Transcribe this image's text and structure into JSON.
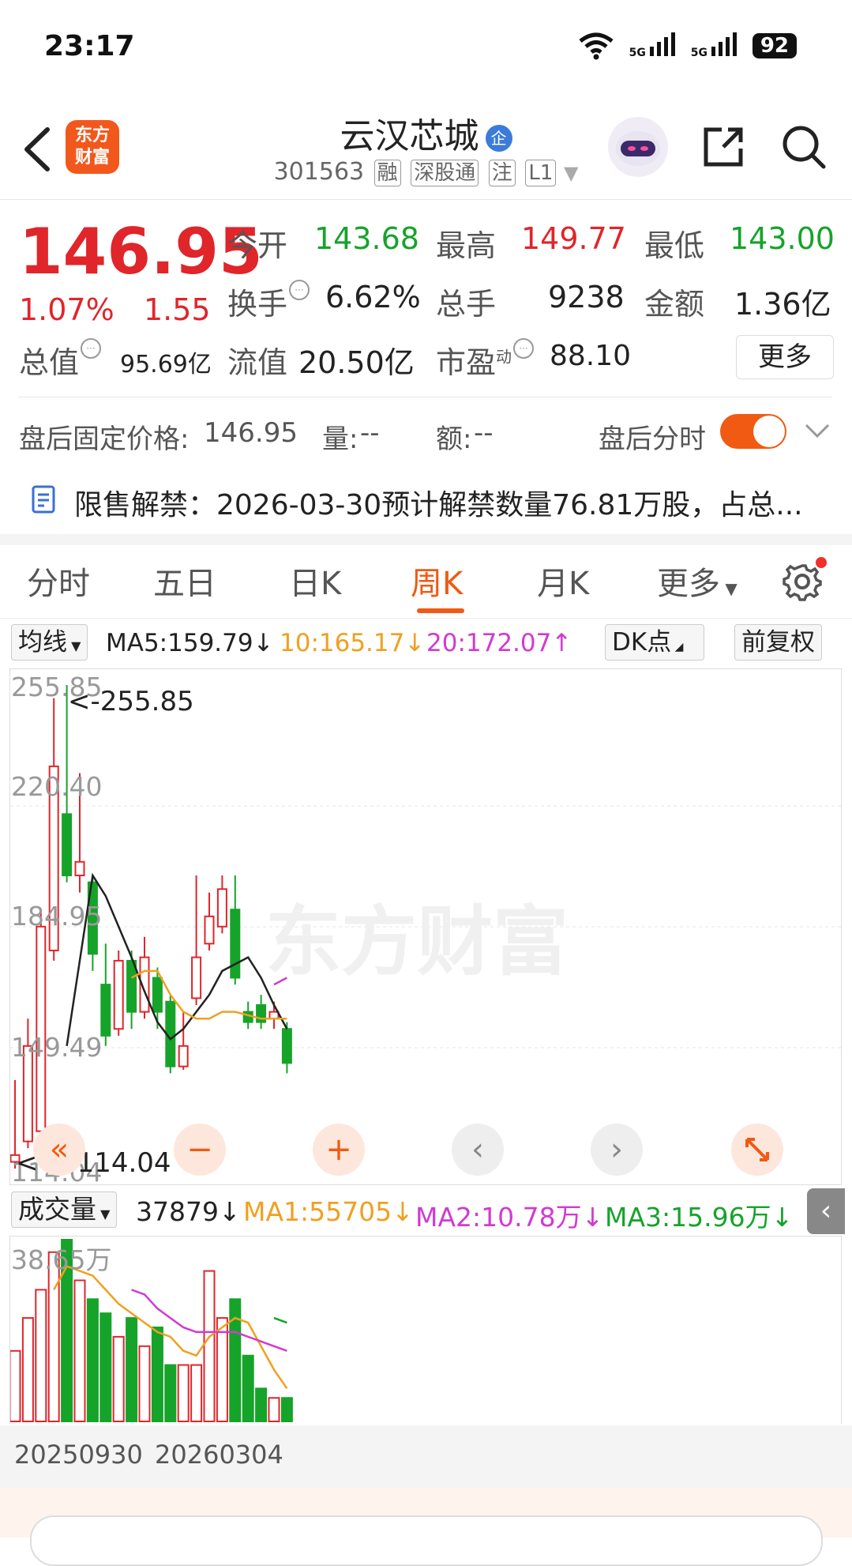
{
  "status": {
    "time": "23:17",
    "network1": "5G",
    "network2": "5G",
    "battery": "92"
  },
  "header": {
    "logo_text_1": "东方",
    "logo_text_2": "财富",
    "title": "云汉芯城",
    "title_badge": "企",
    "code": "301563",
    "tags": [
      "融",
      "深股通",
      "注",
      "L1"
    ]
  },
  "quote": {
    "price": "146.95",
    "change_pct": "1.07%",
    "change": "1.55",
    "open_label": "今开",
    "open": "143.68",
    "high_label": "最高",
    "high": "149.77",
    "low_label": "最低",
    "low": "143.00",
    "turnover_label": "换手",
    "turnover": "6.62%",
    "volume_label": "总手",
    "volume": "9238",
    "amount_label": "金额",
    "amount": "1.36亿",
    "total_cap_label": "总值",
    "total_cap": "95.69亿",
    "float_cap_label": "流值",
    "float_cap": "20.50亿",
    "pe_label": "市盈",
    "pe_sup": "动",
    "pe": "88.10",
    "more_label": "更多"
  },
  "after_hours": {
    "price_label": "盘后固定价格:",
    "price": "146.95",
    "vol_label": "量:",
    "vol": "--",
    "amt_label": "额:",
    "amt": "--",
    "toggle_label": "盘后分时"
  },
  "notice": {
    "text": "限售解禁：2026-03-30预计解禁数量76.81万股，占总..."
  },
  "tabs": [
    "分时",
    "五日",
    "日K",
    "周K",
    "月K",
    "更多"
  ],
  "active_tab": "周K",
  "ma_bar": {
    "selector": "均线",
    "ma5": "MA5:159.79↓",
    "ma10": "10:165.17↓",
    "ma20": "20:172.07↑",
    "dk_label": "DK点",
    "adjust_label": "前复权"
  },
  "chart_labels": {
    "y1": "255.85",
    "y2": "220.40",
    "y3": "184.95",
    "y4": "149.49",
    "y5": "114.04",
    "max_marker": "<-255.85",
    "min_marker": "<----114.04",
    "watermark": "东方财富"
  },
  "vol_bar": {
    "selector": "成交量",
    "value": "37879↓",
    "ma1": "MA1:55705↓",
    "ma2": "MA2:10.78万↓",
    "ma3": "MA3:15.96万↓"
  },
  "vol_labels": {
    "max": "38.65万"
  },
  "dates": {
    "start": "20250930",
    "end": "20260304"
  },
  "colors": {
    "up": "#e0252b",
    "down": "#16a32a",
    "accent": "#f05a13",
    "ma5": "#222222",
    "ma10": "#f0a020",
    "ma20": "#d23ad2"
  },
  "chart_data": {
    "type": "candlestick",
    "ylim": [
      114.04,
      255.85
    ],
    "candles": [
      {
        "o": 116,
        "c": 118,
        "h": 140,
        "l": 114.04
      },
      {
        "o": 122,
        "c": 150,
        "h": 158,
        "l": 120
      },
      {
        "o": 125,
        "c": 185,
        "h": 190,
        "l": 124
      },
      {
        "o": 178,
        "c": 232,
        "h": 252,
        "l": 175
      },
      {
        "o": 218,
        "c": 200,
        "h": 255.85,
        "l": 198
      },
      {
        "o": 200,
        "c": 204,
        "h": 230,
        "l": 195
      },
      {
        "o": 198,
        "c": 177,
        "h": 200,
        "l": 172
      },
      {
        "o": 168,
        "c": 153,
        "h": 180,
        "l": 150
      },
      {
        "o": 155,
        "c": 175,
        "h": 178,
        "l": 153
      },
      {
        "o": 175,
        "c": 160,
        "h": 178,
        "l": 155
      },
      {
        "o": 160,
        "c": 176,
        "h": 182,
        "l": 158
      },
      {
        "o": 170,
        "c": 160,
        "h": 173,
        "l": 155
      },
      {
        "o": 163,
        "c": 144,
        "h": 165,
        "l": 142
      },
      {
        "o": 144,
        "c": 150,
        "h": 160,
        "l": 143
      },
      {
        "o": 164,
        "c": 176,
        "h": 200,
        "l": 162
      },
      {
        "o": 180,
        "c": 188,
        "h": 195,
        "l": 178
      },
      {
        "o": 185,
        "c": 196,
        "h": 200,
        "l": 183
      },
      {
        "o": 190,
        "c": 170,
        "h": 200,
        "l": 168
      },
      {
        "o": 160,
        "c": 157,
        "h": 163,
        "l": 155
      },
      {
        "o": 162,
        "c": 157,
        "h": 165,
        "l": 155
      },
      {
        "o": 158,
        "c": 160,
        "h": 163,
        "l": 155
      },
      {
        "o": 155,
        "c": 145,
        "h": 157,
        "l": 142
      }
    ],
    "ma5": [
      null,
      null,
      null,
      null,
      150,
      175,
      200,
      194,
      185,
      176,
      166,
      157,
      152,
      155,
      160,
      165,
      172,
      174,
      176,
      170,
      162,
      155
    ],
    "ma10": [
      null,
      null,
      null,
      null,
      null,
      null,
      null,
      null,
      null,
      170,
      172,
      172,
      165,
      160,
      158,
      158,
      160,
      160,
      159,
      158,
      158,
      158
    ],
    "ma20": [
      null,
      null,
      null,
      null,
      null,
      null,
      null,
      null,
      null,
      null,
      null,
      null,
      null,
      null,
      null,
      null,
      null,
      null,
      null,
      null,
      168,
      170
    ],
    "volume": [
      15,
      22,
      28,
      36,
      38.65,
      30,
      26,
      23,
      18,
      22,
      16,
      20,
      12,
      12,
      12,
      32,
      22,
      26,
      14,
      7,
      5,
      5
    ],
    "vol_ma1": [
      null,
      null,
      null,
      28,
      33,
      32,
      31,
      28,
      25,
      23,
      21,
      19,
      18,
      15,
      14,
      18,
      20,
      22,
      21,
      16,
      11,
      7
    ],
    "vol_ma2": [
      null,
      null,
      null,
      null,
      null,
      null,
      null,
      null,
      null,
      28,
      27,
      24,
      22,
      20,
      19,
      19,
      19,
      19,
      18,
      17,
      16,
      15
    ],
    "vol_ma3": [
      null,
      null,
      null,
      null,
      null,
      null,
      null,
      null,
      null,
      null,
      null,
      null,
      null,
      null,
      null,
      null,
      null,
      null,
      null,
      null,
      22,
      21
    ],
    "vol_ylim": [
      0,
      38.65
    ]
  }
}
